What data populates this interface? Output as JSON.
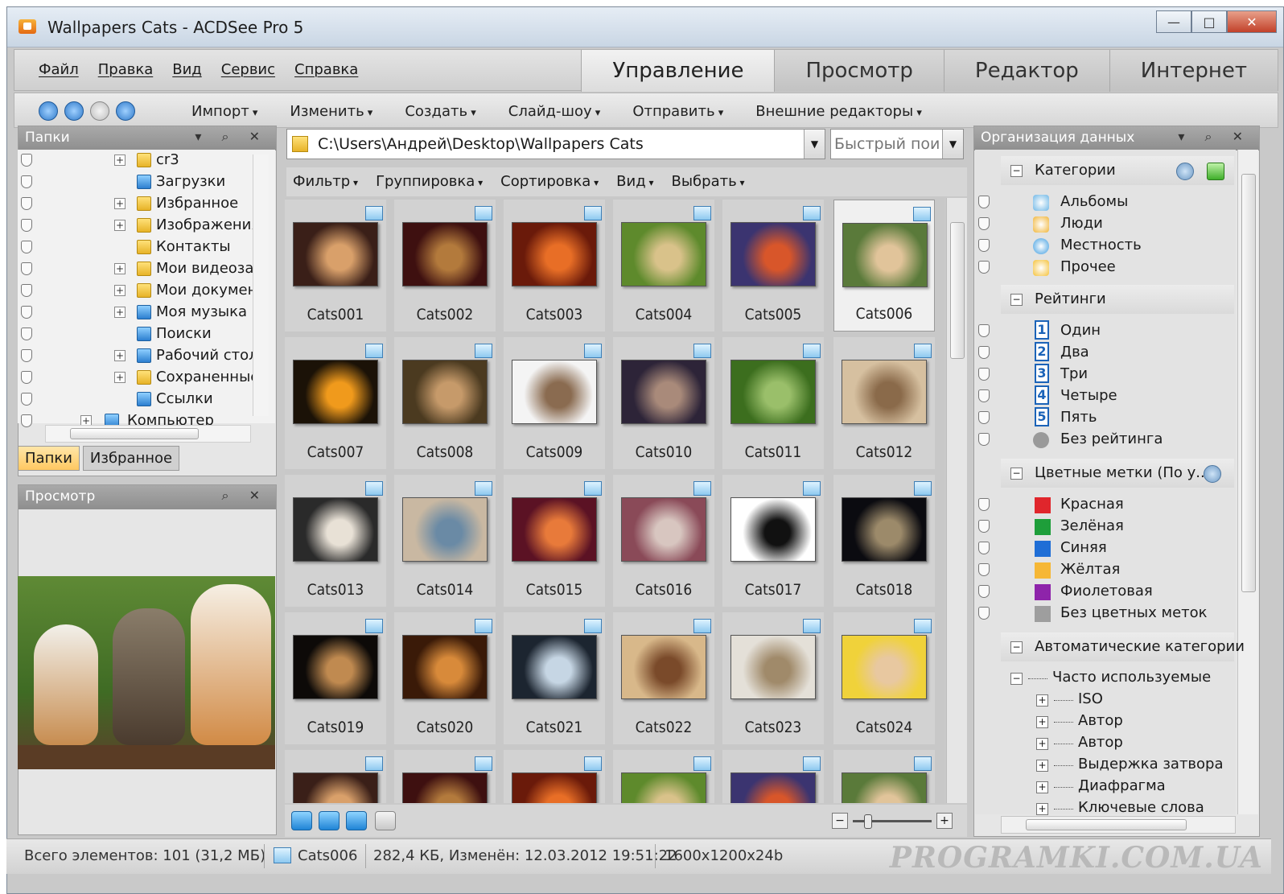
{
  "window": {
    "title": "Wallpapers Cats - ACDSee Pro 5"
  },
  "menu": [
    "Файл",
    "Правка",
    "Вид",
    "Сервис",
    "Справка"
  ],
  "mode_tabs": [
    "Управление",
    "Просмотр",
    "Редактор",
    "Интернет"
  ],
  "toolbar": [
    "Импорт",
    "Изменить",
    "Создать",
    "Слайд-шоу",
    "Отправить",
    "Внешние редакторы"
  ],
  "folders_panel": {
    "title": "Папки",
    "items": [
      "cr3",
      "Загрузки",
      "Избранное",
      "Изображения",
      "Контакты",
      "Мои видеозаг",
      "Мои документ",
      "Моя музыка",
      "Поиски",
      "Рабочий стол",
      "Сохраненные",
      "Ссылки",
      "Компьютер"
    ],
    "tabs": [
      "Папки",
      "Избранное"
    ]
  },
  "preview_panel": {
    "title": "Просмотр"
  },
  "browser": {
    "path": "C:\\Users\\Андрей\\Desktop\\Wallpapers Cats",
    "quick_search_placeholder": "Быстрый пои",
    "filter_items": [
      "Фильтр",
      "Группировка",
      "Сортировка",
      "Вид",
      "Выбрать"
    ],
    "thumbnails": [
      "Cats001",
      "Cats002",
      "Cats003",
      "Cats004",
      "Cats005",
      "Cats006",
      "Cats007",
      "Cats008",
      "Cats009",
      "Cats010",
      "Cats011",
      "Cats012",
      "Cats013",
      "Cats014",
      "Cats015",
      "Cats016",
      "Cats017",
      "Cats018",
      "Cats019",
      "Cats020",
      "Cats021",
      "Cats022",
      "Cats023",
      "Cats024"
    ],
    "selected": "Cats006"
  },
  "organize_panel": {
    "title": "Организация данных",
    "categories_title": "Категории",
    "categories": [
      "Альбомы",
      "Люди",
      "Местность",
      "Прочее"
    ],
    "ratings_title": "Рейтинги",
    "ratings": [
      {
        "num": "1",
        "label": "Один"
      },
      {
        "num": "2",
        "label": "Два"
      },
      {
        "num": "3",
        "label": "Три"
      },
      {
        "num": "4",
        "label": "Четыре"
      },
      {
        "num": "5",
        "label": "Пять"
      },
      {
        "num": "",
        "label": "Без рейтинга"
      }
    ],
    "color_labels_title": "Цветные метки (По у...",
    "color_labels": [
      {
        "label": "Красная",
        "color": "#e0262c"
      },
      {
        "label": "Зелёная",
        "color": "#1e9e3a"
      },
      {
        "label": "Синяя",
        "color": "#1f6ed6"
      },
      {
        "label": "Жёлтая",
        "color": "#f6b735"
      },
      {
        "label": "Фиолетовая",
        "color": "#8e24aa"
      },
      {
        "label": "Без цветных меток",
        "color": "#9e9e9e"
      }
    ],
    "auto_title": "Автоматические категории",
    "auto_root": "Часто используемые",
    "auto_items": [
      "ISO",
      "Автор",
      "Автор",
      "Выдержка затвора",
      "Диафрагма",
      "Ключевые слова"
    ]
  },
  "status": {
    "total": "Всего элементов: 101  (31,2 МБ)",
    "file": "Cats006",
    "info": "282,4 КБ, Изменён: 12.03.2012 19:51:22",
    "dims": "1600x1200x24b",
    "watermark": "PROGRAMKI.COM.UA"
  }
}
